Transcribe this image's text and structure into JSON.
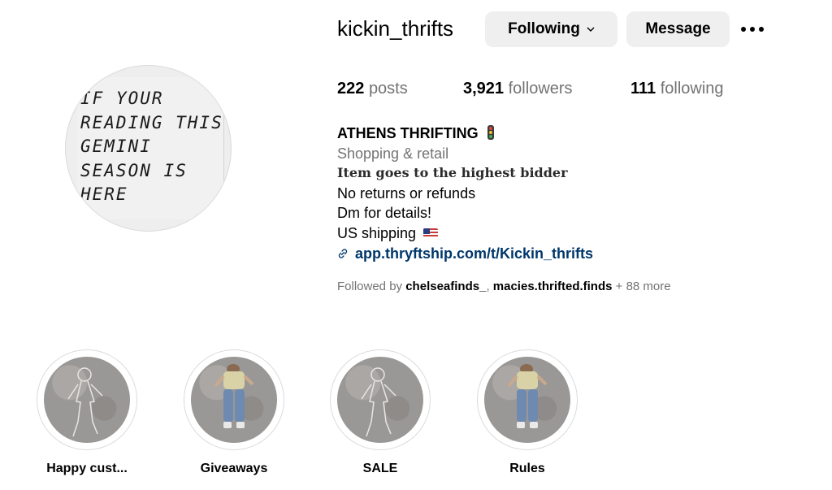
{
  "profile": {
    "username": "kickin_thrifts",
    "following_label": "Following",
    "message_label": "Message",
    "avatar_text": [
      "IF YOUR",
      "READING THIS",
      "GEMINI",
      "SEASON IS",
      "HERE"
    ]
  },
  "stats": {
    "posts_count": "222",
    "posts_label": "posts",
    "followers_count": "3,921",
    "followers_label": "followers",
    "following_count": "111",
    "following_label": "following"
  },
  "bio": {
    "name": "ATHENS THRIFTING",
    "category": "Shopping & retail",
    "line1": "Item goes to the highest bidder",
    "line2": "No returns or refunds",
    "line3": "Dm for details!",
    "line4": "US shipping",
    "link": "app.thryftship.com/t/Kickin_thrifts"
  },
  "followed_by": {
    "prefix": "Followed by",
    "user1": "chelseafinds_",
    "separator": ",",
    "user2": "macies.thrifted.finds",
    "suffix": "+ 88 more"
  },
  "highlights": [
    {
      "label": "Happy cust...",
      "image": "chalk-outline"
    },
    {
      "label": "Giveaways",
      "image": "person-lying"
    },
    {
      "label": "SALE",
      "image": "chalk-outline"
    },
    {
      "label": "Rules",
      "image": "person-lying"
    }
  ],
  "colors": {
    "button_bg": "#efefef",
    "muted_text": "#737373",
    "link": "#00376b"
  }
}
